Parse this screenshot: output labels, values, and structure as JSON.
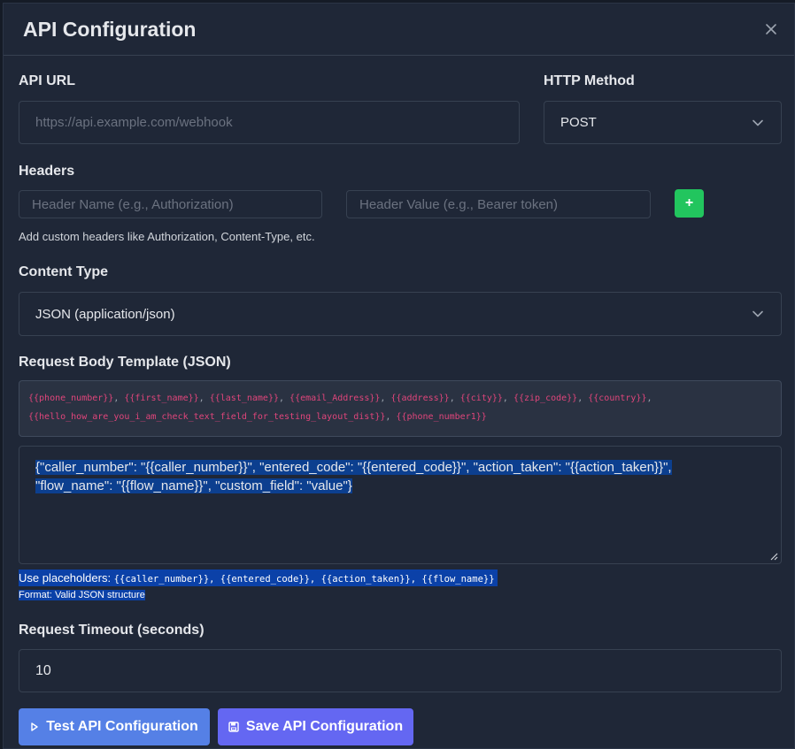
{
  "modal": {
    "title": "API Configuration"
  },
  "api_url": {
    "label": "API URL",
    "placeholder": "https://api.example.com/webhook",
    "value": ""
  },
  "http_method": {
    "label": "HTTP Method",
    "selected": "POST"
  },
  "headers": {
    "label": "Headers",
    "name_placeholder": "Header Name (e.g., Authorization)",
    "value_placeholder": "Header Value (e.g., Bearer token)",
    "add_label": "+",
    "help": "Add custom headers like Authorization, Content-Type, etc."
  },
  "content_type": {
    "label": "Content Type",
    "selected": "JSON (application/json)"
  },
  "request_body": {
    "label": "Request Body Template (JSON)",
    "placeholders": [
      "{{phone_number}}",
      "{{first_name}}",
      "{{last_name}}",
      "{{email_Address}}",
      "{{address}}",
      "{{city}}",
      "{{zip_code}}",
      "{{country}}",
      "{{hello_how_are_you_i_am_check_text_field_for_testing_layout_dist}}",
      "{{phone_number1}}"
    ],
    "template_line1": "{\"caller_number\": \"{{caller_number}}\", \"entered_code\": \"{{entered_code}}\", \"action_taken\": \"{{action_taken}}\",",
    "template_line2": "\"flow_name\": \"{{flow_name}}\", \"custom_field\": \"value\"}",
    "help_prefix": "Use placeholders: ",
    "help_codes": "{{caller_number}}, {{entered_code}}, {{action_taken}}, {{flow_name}}",
    "format_note": "Format: Valid JSON structure"
  },
  "timeout": {
    "label": "Request Timeout (seconds)",
    "value": "10"
  },
  "buttons": {
    "test_label": "Test API Configuration",
    "save_label": "Save API Configuration"
  },
  "colors": {
    "background": "#1f2737",
    "accent_test": "#5580e6",
    "accent_save": "#6467f2",
    "add_green": "#22c55e",
    "placeholder_pink": "#e0457b",
    "selection_blue": "#0b41a8"
  }
}
